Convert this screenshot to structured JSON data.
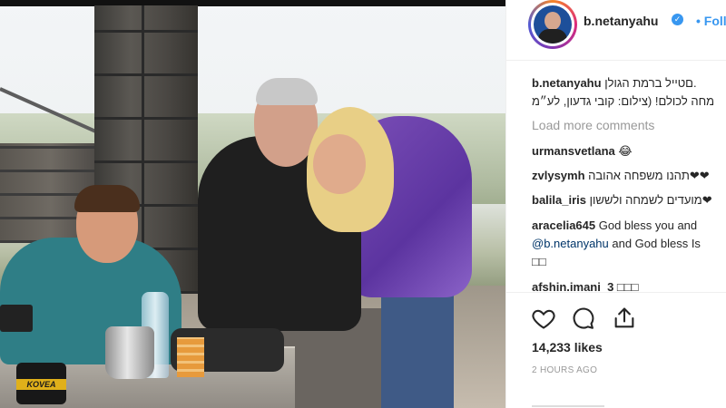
{
  "post": {
    "username": "b.netanyahu",
    "follow_label": "• Follow",
    "caption_user": "b.netanyahu",
    "caption_line1": "םטייל ברמת הגולן.",
    "caption_line2": "מחה לכולם! (צילום: קובי גדעון, לע״מ"
  },
  "comments": {
    "load_more": "Load more comments",
    "items": [
      {
        "user": "urmansvetlana",
        "text": " 😂"
      },
      {
        "user": "zvlysymh",
        "text": " תהנו משפחה אהובה❤❤"
      },
      {
        "user": "balila_iris",
        "text": " מועדים לשמחה ולששון❤"
      },
      {
        "user": "aracelia645",
        "text": " God bless you and"
      },
      {
        "user": "",
        "mention": "@b.netanyahu",
        "text": " and God bless Is"
      },
      {
        "user": "",
        "text": "□□"
      },
      {
        "user": "afshin.imani_3",
        "text": " □□□"
      }
    ]
  },
  "actions": {
    "likes": "14,233 likes",
    "time": "2 HOURS AGO"
  },
  "photo": {
    "canister_label": "KOVEA"
  },
  "colors": {
    "link_blue": "#3897f0",
    "text": "#262626",
    "muted": "#999999"
  },
  "icons": [
    "heart-icon",
    "comment-icon",
    "share-icon",
    "verified-icon"
  ]
}
